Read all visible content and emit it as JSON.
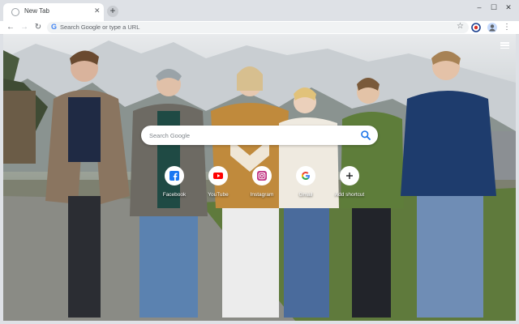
{
  "browser": {
    "tab_title": "New Tab",
    "tab_close": "✕",
    "new_tab": "+",
    "omnibox_placeholder": "Search Google or type a URL",
    "g_logo": "G"
  },
  "ntp": {
    "search_placeholder": "Search Google",
    "shortcuts": [
      {
        "label": "Facebook",
        "icon": "facebook-icon",
        "color": "#1877f2"
      },
      {
        "label": "YouTube",
        "icon": "youtube-icon",
        "color": "#ff0000"
      },
      {
        "label": "Instagram",
        "icon": "instagram-icon",
        "color": "#c13584"
      },
      {
        "label": "Gmail",
        "icon": "google-icon",
        "color": "#4285f4"
      },
      {
        "label": "Add shortcut",
        "icon": "plus-icon",
        "color": "#202124"
      }
    ]
  },
  "colors": {
    "tabstrip": "#dee1e6",
    "accent": "#1a73e8"
  }
}
